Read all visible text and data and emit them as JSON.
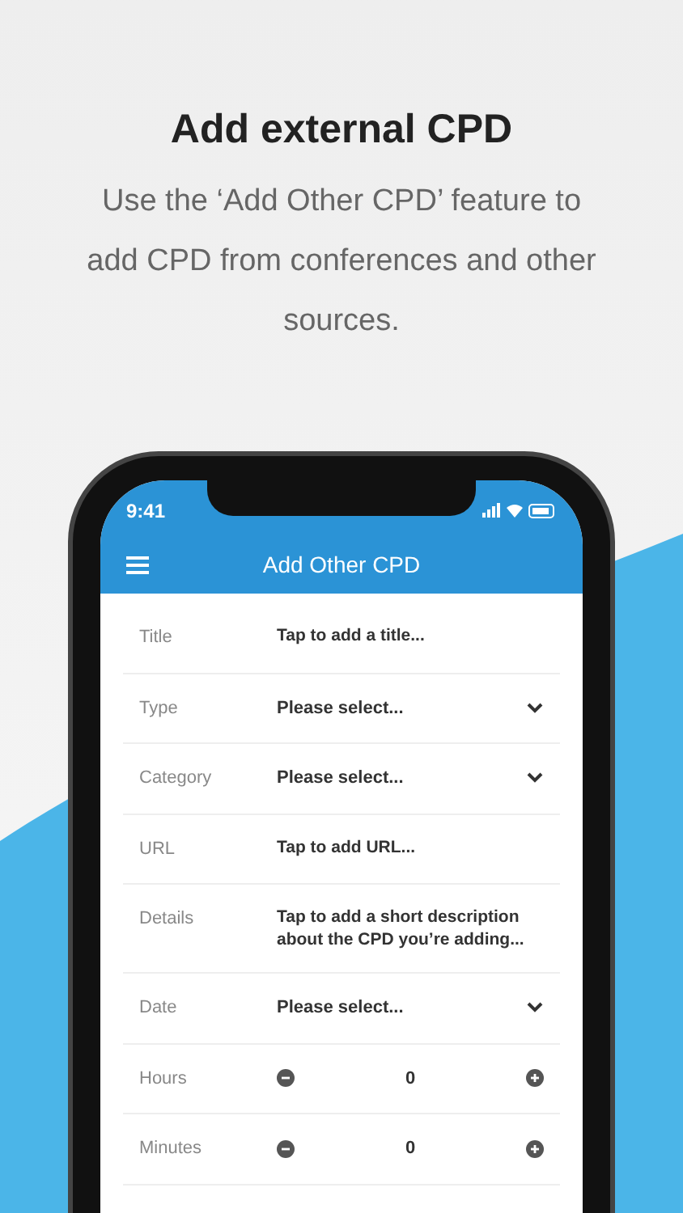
{
  "headline": "Add external CPD",
  "subtitle": "Use the ‘Add Other CPD’ feature to add CPD from conferences and other sources.",
  "status_bar": {
    "time": "9:41"
  },
  "nav_bar": {
    "title": "Add Other CPD"
  },
  "fields": [
    {
      "label": "Title",
      "kind": "text",
      "value": "Tap to add a title..."
    },
    {
      "label": "Type",
      "kind": "select",
      "value": "Please select..."
    },
    {
      "label": "Category",
      "kind": "select",
      "value": "Please select..."
    },
    {
      "label": "URL",
      "kind": "text",
      "value": "Tap to add URL..."
    },
    {
      "label": "Details",
      "kind": "text",
      "value": "Tap to add a short description about the CPD you’re adding..."
    },
    {
      "label": "Date",
      "kind": "select",
      "value": "Please select..."
    },
    {
      "label": "Hours",
      "kind": "stepper",
      "value": "0"
    },
    {
      "label": "Minutes",
      "kind": "stepper",
      "value": "0"
    }
  ]
}
